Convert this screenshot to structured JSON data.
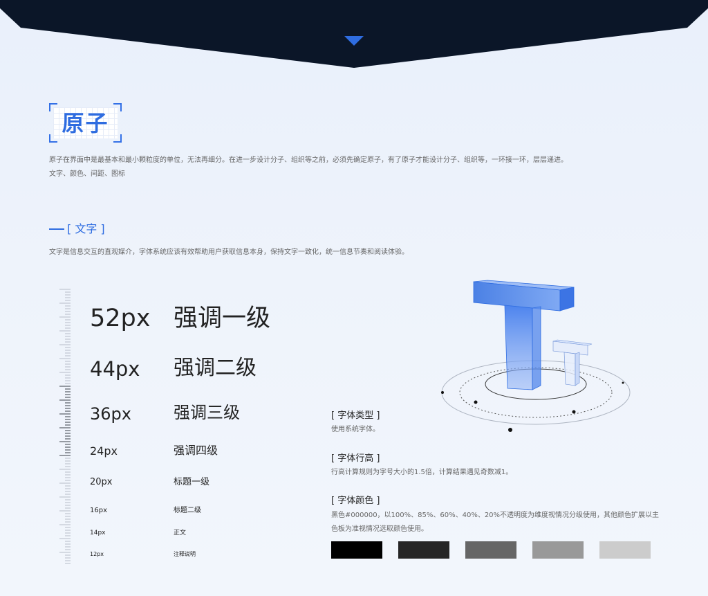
{
  "atom": {
    "title": "原子",
    "desc_line1": "原子在界面中是最基本和最小颗粒度的单位，无法再细分。在进一步设计分子、组织等之前，必须先确定原子，有了原子才能设计分子、组织等，一环接一环，层层递进。",
    "desc_line2": "文字、颜色、间距、图标"
  },
  "text_section": {
    "title": "[ 文字 ]",
    "desc": "文字是信息交互的直观媒介，字体系统应该有效帮助用户获取信息本身，保持文字一致化，统一信息节奏和阅读体验。"
  },
  "type_scale": [
    {
      "size": "52px",
      "label": "强调一级"
    },
    {
      "size": "44px",
      "label": "强调二级"
    },
    {
      "size": "36px",
      "label": "强调三级"
    },
    {
      "size": "24px",
      "label": "强调四级"
    },
    {
      "size": "20px",
      "label": "标题一级"
    },
    {
      "size": "16px",
      "label": "标题二级"
    },
    {
      "size": "14px",
      "label": "正文"
    },
    {
      "size": "12px",
      "label": "注释说明"
    }
  ],
  "info": {
    "font_type_title": "[  字体类型  ]",
    "font_type_desc": "使用系统字体。",
    "line_height_title": "[  字体行高  ]",
    "line_height_desc": "行高计算规则为字号大小的1.5倍，计算结果遇见奇数减1。",
    "font_color_title": "[  字体颜色  ]",
    "font_color_desc1": "黑色#000000，以100%、85%、60%、40%、20%不透明度为维度视情况分级使用，其他颜色扩展以主",
    "font_color_desc2": "色板为准视情况选取颜色使用。"
  },
  "colors": {
    "accent": "#2f6de1",
    "banner": "#0b1628",
    "swatches": [
      "#000000",
      "#262626",
      "#666666",
      "#999999",
      "#cccccc"
    ]
  }
}
